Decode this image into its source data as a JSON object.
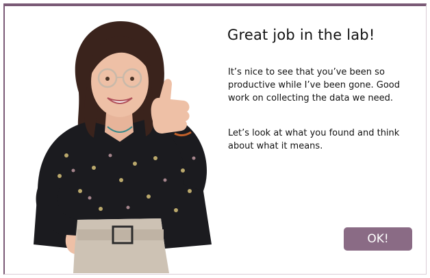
{
  "dialog": {
    "title": "Great job in the lab!",
    "paragraphs": [
      "It’s nice to see that you’ve been so productive while I’ve been gone. Good work on collecting the data we need.",
      "Let’s look at what you found and think about what it means."
    ],
    "ok_label": "OK!"
  },
  "character": {
    "icon": "thumbs-up-scientist-portrait"
  },
  "colors": {
    "accent": "#7a5a76",
    "button": "#8a6b85",
    "text": "#111111",
    "background": "#ffffff"
  }
}
